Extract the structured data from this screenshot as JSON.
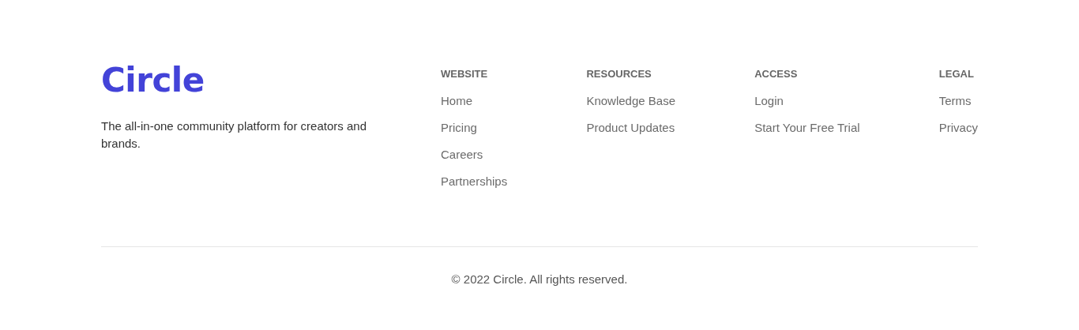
{
  "brand": {
    "logo": "Circle",
    "tagline": "The all-in-one community platform for creators and brands."
  },
  "columns": [
    {
      "heading": "WEBSITE",
      "links": [
        "Home",
        "Pricing",
        "Careers",
        "Partnerships"
      ]
    },
    {
      "heading": "RESOURCES",
      "links": [
        "Knowledge Base",
        "Product Updates"
      ]
    },
    {
      "heading": "ACCESS",
      "links": [
        "Login",
        "Start Your Free Trial"
      ]
    },
    {
      "heading": "LEGAL",
      "links": [
        "Terms",
        "Privacy"
      ]
    }
  ],
  "copyright": "© 2022 Circle. All rights reserved."
}
